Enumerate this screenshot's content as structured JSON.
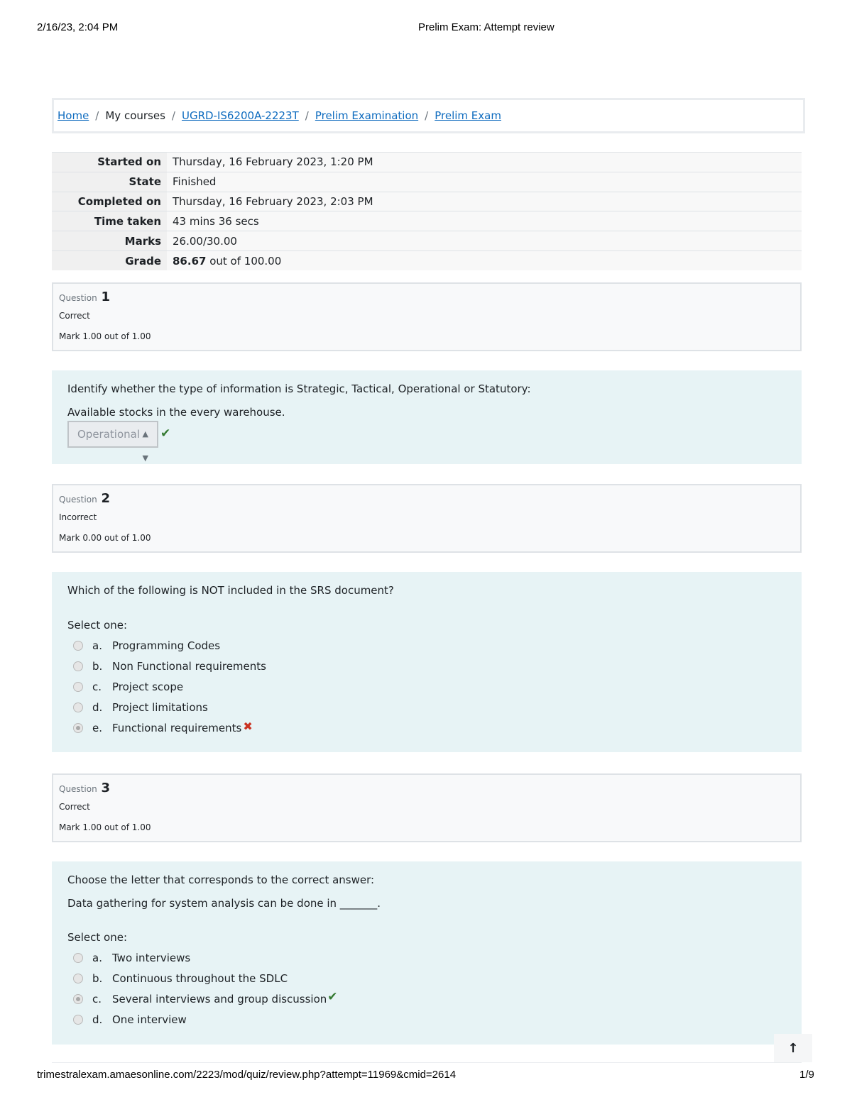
{
  "print_header": {
    "datetime": "2/16/23, 2:04 PM",
    "title": "Prelim Exam: Attempt review"
  },
  "breadcrumb": [
    {
      "label": "Home",
      "link": true
    },
    {
      "label": "My courses",
      "link": false
    },
    {
      "label": "UGRD-IS6200A-2223T",
      "link": true
    },
    {
      "label": "Prelim Examination",
      "link": true
    },
    {
      "label": "Prelim Exam",
      "link": true
    }
  ],
  "breadcrumb_separator": "/",
  "summary": {
    "started_on_label": "Started on",
    "started_on": "Thursday, 16 February 2023, 1:20 PM",
    "state_label": "State",
    "state": "Finished",
    "completed_on_label": "Completed on",
    "completed_on": "Thursday, 16 February 2023, 2:03 PM",
    "time_taken_label": "Time taken",
    "time_taken": "43 mins 36 secs",
    "marks_label": "Marks",
    "marks": "26.00/30.00",
    "grade_label": "Grade",
    "grade_value": "86.67",
    "grade_rest": " out of 100.00"
  },
  "question_label": "Question",
  "select_one_label": "Select one:",
  "questions": [
    {
      "number": "1",
      "state": "Correct",
      "mark": "Mark 1.00 out of 1.00",
      "text": "Identify whether the type of information is Strategic, Tactical, Operational or Statutory:",
      "subtext": "Available stocks in the every warehouse.",
      "selected": "Operational",
      "result_icon": "check"
    },
    {
      "number": "2",
      "state": "Incorrect",
      "mark": "Mark 0.00 out of 1.00",
      "text": "Which of the following is NOT included in the SRS document?",
      "options": [
        {
          "letter": "a.",
          "text": "Programming Codes",
          "checked": false
        },
        {
          "letter": "b.",
          "text": "Non Functional requirements",
          "checked": false
        },
        {
          "letter": "c.",
          "text": "Project scope",
          "checked": false
        },
        {
          "letter": "d.",
          "text": "Project limitations",
          "checked": false
        },
        {
          "letter": "e.",
          "text": "Functional requirements",
          "checked": true,
          "result_icon": "cross"
        }
      ]
    },
    {
      "number": "3",
      "state": "Correct",
      "mark": "Mark 1.00 out of 1.00",
      "text": "Choose the letter that corresponds to the correct answer:",
      "subtext": "Data gathering for system analysis can be done in _______.",
      "options": [
        {
          "letter": "a.",
          "text": "Two interviews",
          "checked": false
        },
        {
          "letter": "b.",
          "text": "Continuous throughout the SDLC",
          "checked": false
        },
        {
          "letter": "c.",
          "text": "Several interviews and group discussion",
          "checked": true,
          "result_icon": "check"
        },
        {
          "letter": "d.",
          "text": "One interview",
          "checked": false
        }
      ]
    }
  ],
  "icons": {
    "check": "✔",
    "cross": "✖",
    "back_to_top": "🡑",
    "select_arrows": "◆"
  },
  "print_footer": {
    "url": "trimestralexam.amaesonline.com/2223/mod/quiz/review.php?attempt=11969&cmid=2614",
    "page": "1/9"
  },
  "colors": {
    "link": "#0f6cbf",
    "correct": "#357a32",
    "incorrect": "#ca3120",
    "question_bg": "#e7f3f5"
  }
}
